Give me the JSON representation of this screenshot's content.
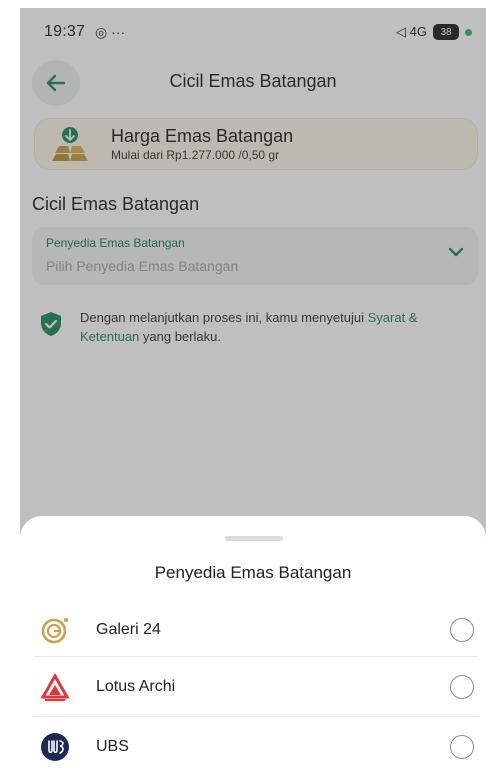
{
  "status": {
    "time": "19:37",
    "left_icons": "◎ ···",
    "right_icons": "◁ 4G",
    "battery": "38"
  },
  "appbar": {
    "title": "Cicil Emas Batangan"
  },
  "price_card": {
    "title": "Harga Emas Batangan",
    "subtitle": "Mulai dari Rp1.277.000 /0,50 gr"
  },
  "section": {
    "title": "Cicil Emas Batangan"
  },
  "provider_field": {
    "label": "Penyedia Emas Batangan",
    "placeholder": "Pilih Penyedia Emas Batangan"
  },
  "consent": {
    "prefix": "Dengan melanjutkan proses ini, kamu menyetujui ",
    "link": "Syarat & Ketentuan",
    "suffix": " yang berlaku."
  },
  "sheet": {
    "title": "Penyedia Emas Batangan",
    "options": [
      {
        "name": "Galeri 24",
        "icon": "galeri24-logo-icon"
      },
      {
        "name": "Lotus Archi",
        "icon": "lotus-archi-logo-icon"
      },
      {
        "name": "UBS",
        "icon": "ubs-logo-icon"
      }
    ]
  },
  "colors": {
    "accent_green": "#1d8a5b",
    "gold": "#c9a24a"
  }
}
